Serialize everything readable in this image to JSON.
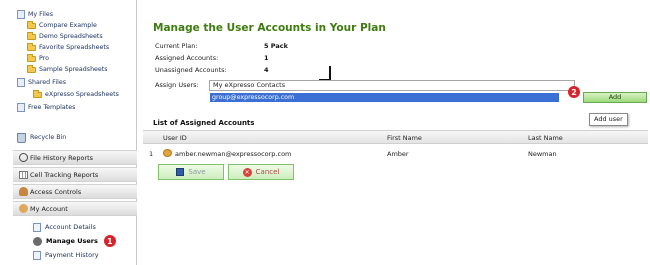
{
  "sidebar": {
    "files_tree": [
      {
        "label": "My Files",
        "icon": "page-icon"
      },
      {
        "label": "Compare Example",
        "icon": "folder-icon"
      },
      {
        "label": "Demo Spreadsheets",
        "icon": "folder-icon"
      },
      {
        "label": "Favorite Spreadsheets",
        "icon": "folder-icon"
      },
      {
        "label": "Pro",
        "icon": "folder-icon"
      },
      {
        "label": "Sample Spreadsheets",
        "icon": "folder-icon"
      },
      {
        "label": "Shared Files",
        "icon": "page-icon"
      },
      {
        "label": "eXpresso Spreadsheets",
        "icon": "folder-icon"
      },
      {
        "label": "Free Templates",
        "icon": "page-icon"
      }
    ],
    "recycle_bin": "Recycle Bin",
    "sections": [
      {
        "label": "File History Reports",
        "icon": "clock-icon"
      },
      {
        "label": "Cell Tracking Reports",
        "icon": "grid-icon"
      },
      {
        "label": "Access Controls",
        "icon": "people-icon"
      },
      {
        "label": "My Account",
        "icon": "user-icon"
      }
    ],
    "account_items": [
      {
        "label": "Account Details",
        "active": false
      },
      {
        "label": "Manage Users",
        "active": true
      },
      {
        "label": "Payment History",
        "active": false
      }
    ],
    "badge_1": "1"
  },
  "main": {
    "title": "Manage the User Accounts in Your Plan",
    "stats": [
      {
        "label": "Current Plan:",
        "value": "5 Pack"
      },
      {
        "label": "Assigned Accounts:",
        "value": "1"
      },
      {
        "label": "Unassigned Accounts:",
        "value": "4"
      }
    ],
    "assign_label": "Assign Users:",
    "assign_value": "My eXpresso Contacts",
    "dropdown_option": "group@expressocorp.com",
    "badge_2": "2",
    "add_label": "Add",
    "tooltip": "Add user",
    "list_title": "List of Assigned Accounts",
    "columns": [
      "User ID",
      "First Name",
      "Last Name"
    ],
    "rows": [
      {
        "num": "1",
        "user_id": "amber.newman@expressocorp.com",
        "first": "Amber",
        "last": "Newman"
      }
    ],
    "save_label": "Save",
    "cancel_label": "Cancel"
  },
  "colors": {
    "title_green": "#3e7c0f",
    "badge_red": "#d9232a",
    "selection_blue": "#3b6fd4",
    "button_green": "#9fd97b"
  }
}
